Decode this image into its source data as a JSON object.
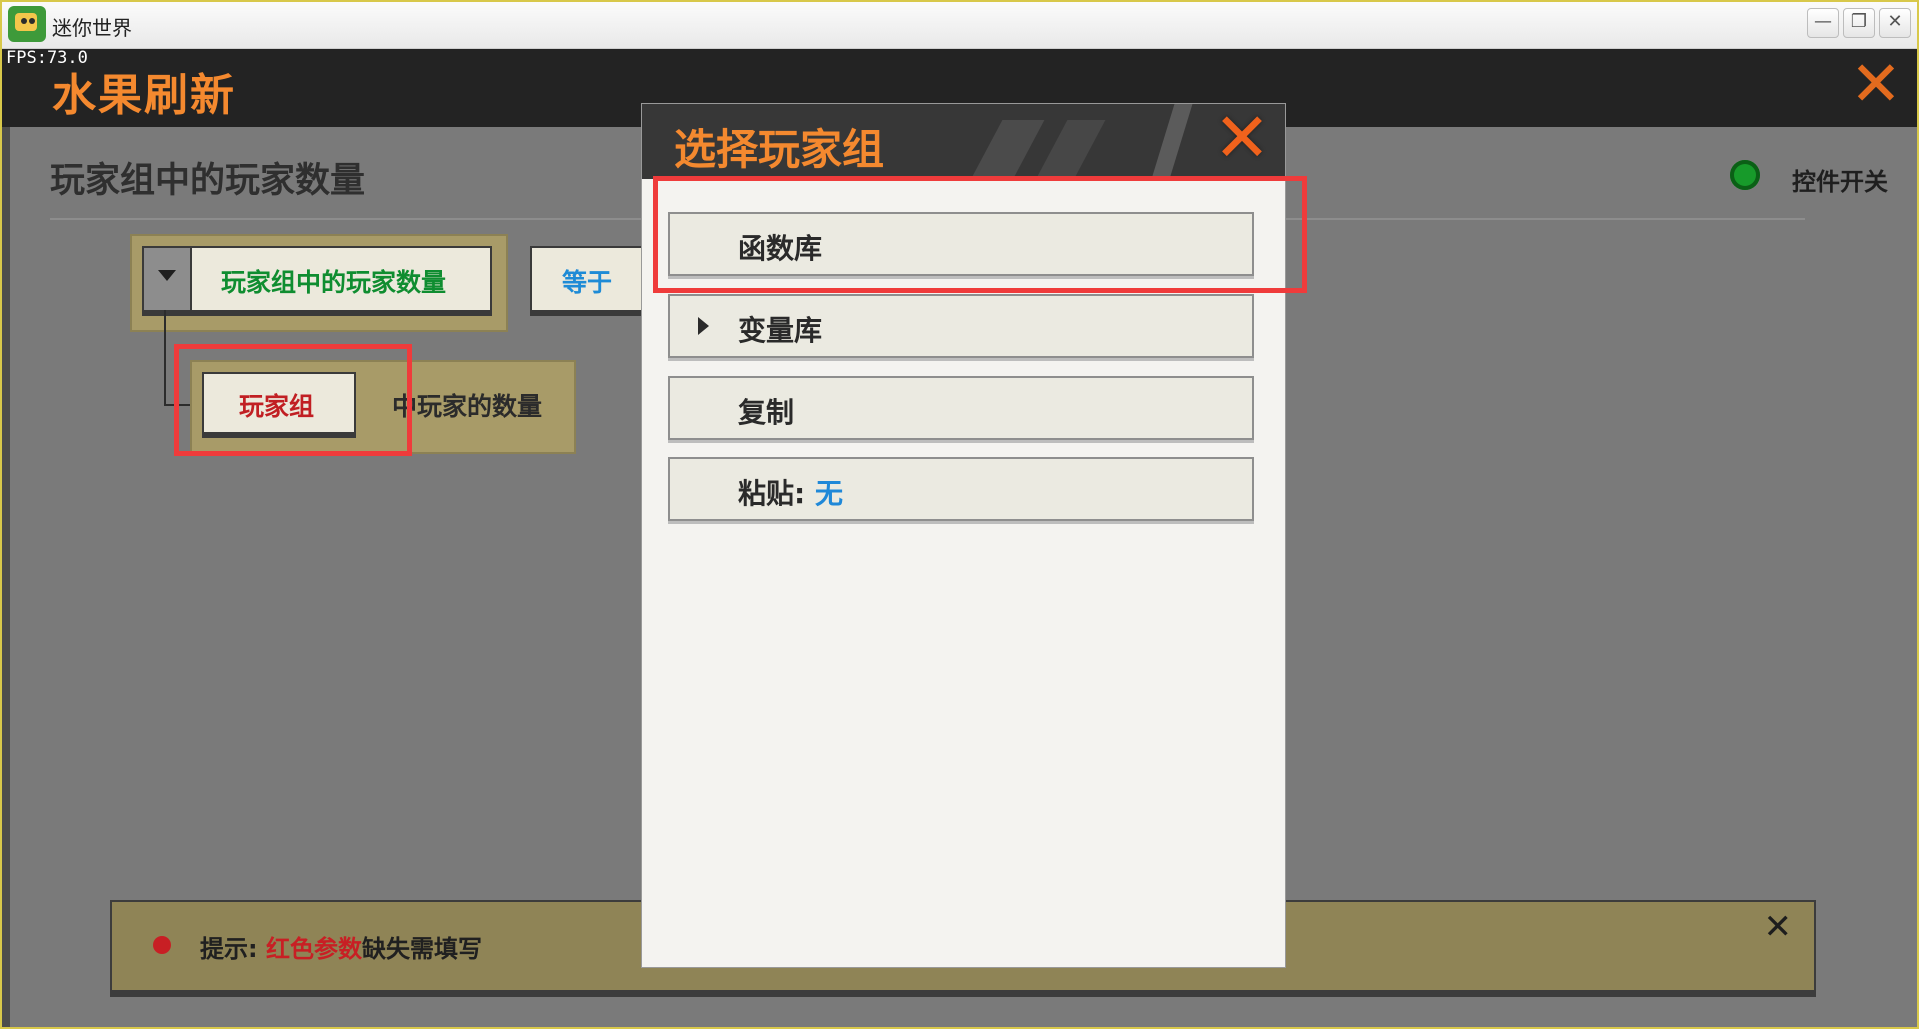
{
  "window": {
    "title": "迷你世界",
    "fps": "FPS:73.0",
    "icons": {
      "app": "mini-world-icon",
      "minimize": "minimize-icon",
      "restore": "restore-icon",
      "close": "close-icon"
    }
  },
  "page": {
    "title": "水果刷新",
    "close_icon": "close-x-icon",
    "section_title": "玩家组中的玩家数量",
    "toggle_label": "控件开关",
    "toggle_color": "#179a2a"
  },
  "editor": {
    "main_param": "玩家组中的玩家数量",
    "equals_label": "等于",
    "sub_param": "玩家组",
    "sub_suffix": "中玩家的数量"
  },
  "hint": {
    "prefix": "提示: ",
    "highlight": "红色参数",
    "suffix": "缺失需填写",
    "close_icon": "close-icon"
  },
  "modal": {
    "title": "选择玩家组",
    "close_icon": "close-x-icon",
    "items": [
      {
        "label": "函数库"
      },
      {
        "label": "变量库",
        "has_arrow": true
      },
      {
        "label": "复制"
      },
      {
        "label": "粘贴: ",
        "value": "无"
      }
    ]
  },
  "colors": {
    "accent_orange": "#f4892f",
    "highlight_red": "#ef3b3b",
    "param_green": "#0f8d30",
    "param_red": "#c11f23",
    "value_blue": "#1f88d8"
  }
}
